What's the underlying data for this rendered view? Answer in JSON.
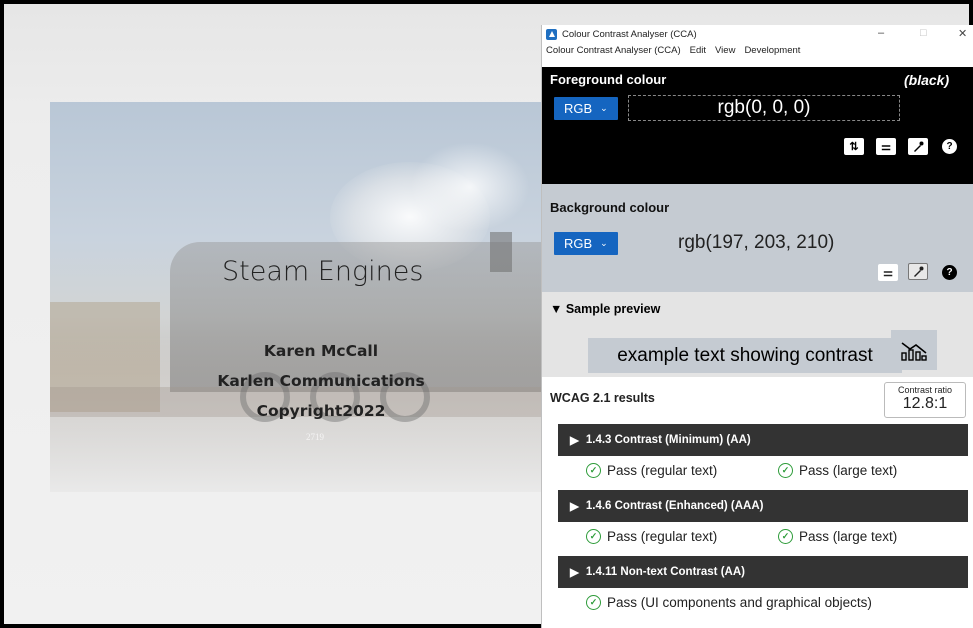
{
  "slide": {
    "title": "Steam Engines",
    "author": "Karen McCall",
    "company": "Karlen Communications",
    "copyright": "Copyright2022",
    "photo_number": "2719"
  },
  "window": {
    "title": "Colour Contrast Analyser (CCA)",
    "controls": {
      "minimize": "–",
      "maximize": "□",
      "close": "✕"
    },
    "menu": [
      "Colour Contrast Analyser (CCA)",
      "Edit",
      "View",
      "Development"
    ]
  },
  "foreground": {
    "title": "Foreground colour",
    "name": "(black)",
    "format": "RGB",
    "value": "rgb(0, 0, 0)",
    "color": "#000000",
    "tools": [
      "swap-icon",
      "sliders-icon",
      "eyedropper-icon",
      "help-icon"
    ]
  },
  "background": {
    "title": "Background colour",
    "format": "RGB",
    "value": "rgb(197, 203, 210)",
    "color": "#c5cbd2",
    "tools": [
      "sliders-icon",
      "eyedropper-icon",
      "help-icon"
    ]
  },
  "preview": {
    "title": "▼ Sample preview",
    "sample_text": "example text showing contrast",
    "icon": "chart-icon"
  },
  "results": {
    "title": "WCAG 2.1 results",
    "ratio_label": "Contrast ratio",
    "ratio_value": "12.8:1",
    "criteria": [
      {
        "label": "1.4.3 Contrast (Minimum) (AA)",
        "passes": [
          "Pass (regular text)",
          "Pass (large text)"
        ]
      },
      {
        "label": "1.4.6 Contrast (Enhanced) (AAA)",
        "passes": [
          "Pass (regular text)",
          "Pass (large text)"
        ]
      },
      {
        "label": "1.4.11 Non-text Contrast (AA)",
        "passes": [
          "Pass (UI components and graphical objects)"
        ]
      }
    ]
  },
  "colors": {
    "pass_green": "#2e9c3a",
    "format_blue": "#1565c0",
    "criterion_bar": "#333333"
  }
}
